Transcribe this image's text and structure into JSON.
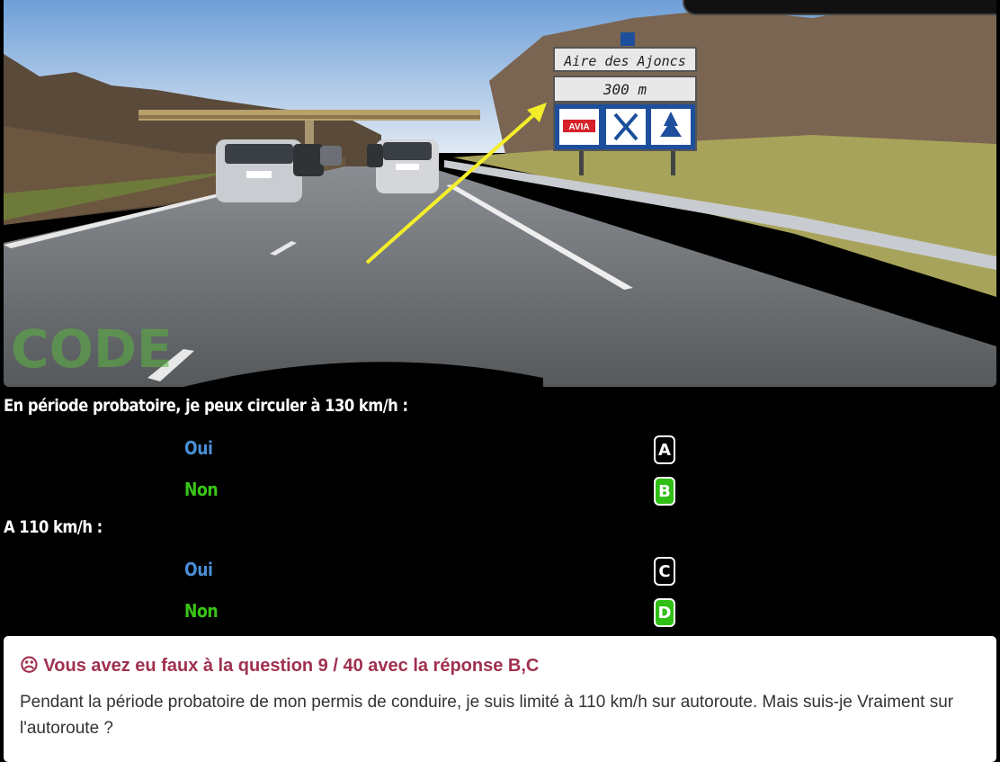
{
  "scene": {
    "sign_name": "Aire des Ajoncs",
    "sign_distance": "300 m",
    "fuel_brand": "AVIA",
    "watermark": "CODE"
  },
  "question1": {
    "text": "En période probatoire, je peux circuler à 130 km/h :",
    "answers": [
      {
        "label": "Oui",
        "key": "A",
        "correct": false,
        "color": "#4a8fd6"
      },
      {
        "label": "Non",
        "key": "B",
        "correct": true,
        "color": "#39c516"
      }
    ]
  },
  "question2": {
    "text": "A 110 km/h :",
    "answers": [
      {
        "label": "Oui",
        "key": "C",
        "correct": false,
        "color": "#4a8fd6"
      },
      {
        "label": "Non",
        "key": "D",
        "correct": true,
        "color": "#39c516"
      }
    ]
  },
  "feedback": {
    "title": "☹ Vous avez eu faux à la question 9 / 40 avec la réponse B,C",
    "body": "Pendant la période probatoire de mon permis de conduire, je suis limité à 110 km/h sur autoroute. Mais suis-je Vraiment sur l'autoroute ?"
  }
}
